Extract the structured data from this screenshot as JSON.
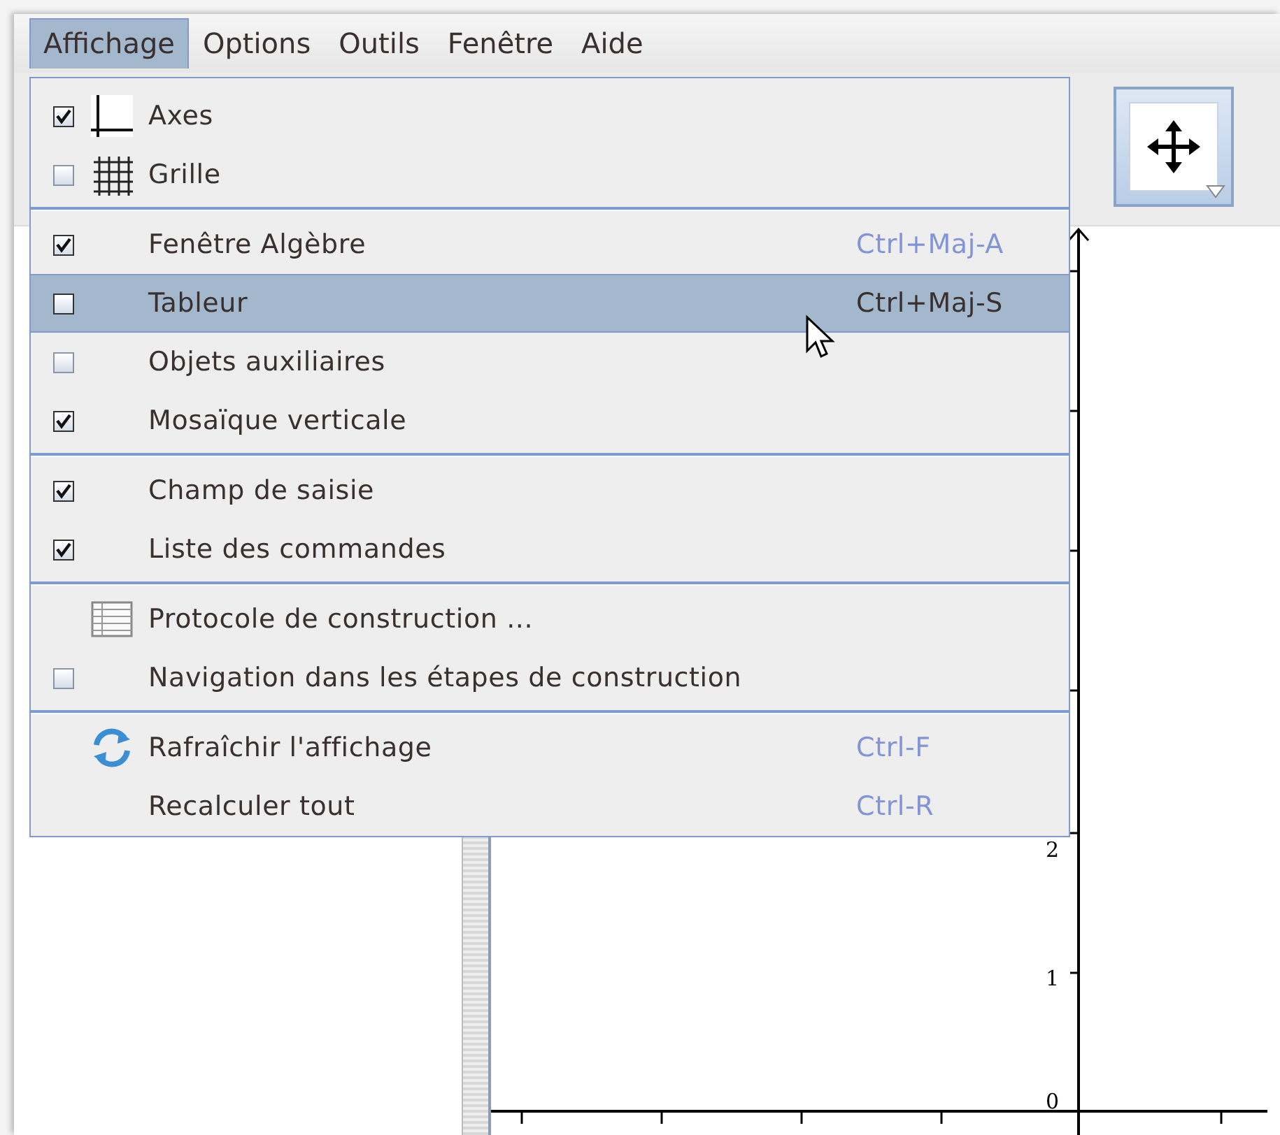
{
  "menubar": [
    {
      "label": "Affichage",
      "selected": true
    },
    {
      "label": "Options",
      "selected": false
    },
    {
      "label": "Outils",
      "selected": false
    },
    {
      "label": "Fenêtre",
      "selected": false
    },
    {
      "label": "Aide",
      "selected": false
    }
  ],
  "menu": {
    "groups": [
      [
        {
          "kind": "check",
          "label": "Axes",
          "checked": true,
          "selected": false
        },
        {
          "kind": "check",
          "label": "Grille",
          "checked": false,
          "selected": false
        }
      ],
      [
        {
          "kind": "check",
          "label": "Fenêtre Algèbre",
          "checked": true,
          "shortcut": "Ctrl+Maj-A",
          "selected": false
        },
        {
          "kind": "check",
          "label": "Tableur",
          "checked": false,
          "shortcut": "Ctrl+Maj-S",
          "selected": true
        },
        {
          "kind": "check",
          "label": "Objets auxiliaires",
          "checked": false,
          "selected": false
        },
        {
          "kind": "check",
          "label": "Mosaïque verticale",
          "checked": true,
          "selected": false
        }
      ],
      [
        {
          "kind": "check",
          "label": "Champ de saisie",
          "checked": true,
          "selected": false
        },
        {
          "kind": "check",
          "label": "Liste des commandes",
          "checked": true,
          "selected": false
        }
      ],
      [
        {
          "kind": "action",
          "label": "Protocole de construction ...",
          "selected": false
        },
        {
          "kind": "check",
          "label": "Navigation dans les étapes de construction",
          "checked": false,
          "selected": false
        }
      ],
      [
        {
          "kind": "action",
          "label": "Rafraîchir l'affichage",
          "shortcut": "Ctrl-F",
          "selected": false
        },
        {
          "kind": "action",
          "label": "Recalculer tout",
          "shortcut": "Ctrl-R",
          "selected": false
        }
      ]
    ]
  },
  "graphics": {
    "y_labels": [
      "2",
      "1",
      "0"
    ]
  }
}
